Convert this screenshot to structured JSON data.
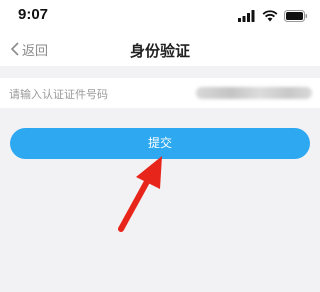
{
  "status_bar": {
    "time": "9:07",
    "icons": [
      "signal-icon",
      "wifi-icon",
      "battery-icon"
    ]
  },
  "nav": {
    "back_label": "返回",
    "title": "身份验证"
  },
  "form": {
    "id_field": {
      "placeholder": "请输入认证证件号码",
      "value_blurred": true
    },
    "submit_label": "提交"
  },
  "annotation": {
    "arrow_color": "#e8251a",
    "points_to": "submit-button"
  },
  "colors": {
    "accent": "#2ea9f1",
    "background": "#f2f2f4"
  }
}
